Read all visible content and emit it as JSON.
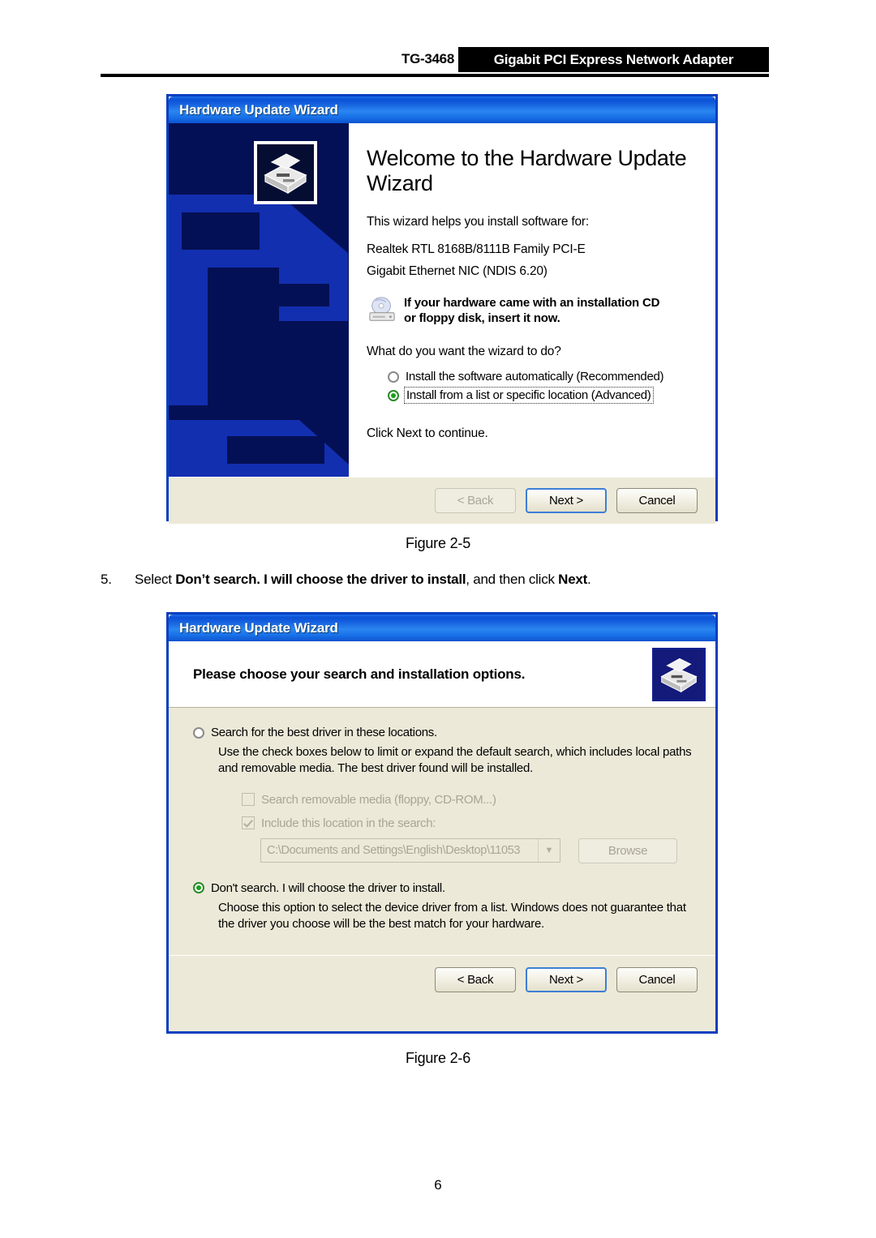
{
  "header": {
    "model": "TG-3468",
    "product": "Gigabit PCI Express Network Adapter"
  },
  "dialog_welcome": {
    "titlebar": "Hardware Update Wizard",
    "heading": "Welcome to the Hardware Update Wizard",
    "intro": "This wizard helps you install software for:",
    "device_line1": "Realtek RTL 8168B/8111B Family PCI-E",
    "device_line2": "Gigabit Ethernet NIC (NDIS 6.20)",
    "cd_note_line1": "If your hardware came with an installation CD",
    "cd_note_line2": "or floppy disk, insert it now.",
    "question": "What do you want the wizard to do?",
    "options": [
      {
        "label": "Install the software automatically (Recommended)",
        "selected": false,
        "focused": false
      },
      {
        "label": "Install from a list or specific location (Advanced)",
        "selected": true,
        "focused": true
      }
    ],
    "click_next": "Click Next to continue.",
    "buttons": [
      {
        "label": "< Back",
        "state": "disabled"
      },
      {
        "label": "Next >",
        "state": "default"
      },
      {
        "label": "Cancel",
        "state": "normal"
      }
    ]
  },
  "dialog_options": {
    "titlebar": "Hardware Update Wizard",
    "heading": "Please choose your search and installation options.",
    "option_search": {
      "label": "Search for the best driver in these locations.",
      "selected": false,
      "description": "Use the check boxes below to limit or expand the default search, which includes local paths and removable media. The best driver found will be installed."
    },
    "checkbox_removable": {
      "label": "Search removable media (floppy, CD-ROM...)",
      "checked": false,
      "enabled": false
    },
    "checkbox_include": {
      "label": "Include this location in the search:",
      "checked": true,
      "enabled": false
    },
    "path_combo": {
      "value": "C:\\Documents and Settings\\English\\Desktop\\11053",
      "enabled": false
    },
    "browse_button": {
      "label": "Browse",
      "enabled": false
    },
    "option_dontsearch": {
      "label": "Don't search. I will choose the driver to install.",
      "selected": true,
      "description": "Choose this option to select the device driver from a list.  Windows does not guarantee that the driver you choose will be the best match for your hardware."
    },
    "buttons": [
      {
        "label": "< Back",
        "state": "normal"
      },
      {
        "label": "Next >",
        "state": "default"
      },
      {
        "label": "Cancel",
        "state": "normal"
      }
    ]
  },
  "captions": {
    "figure_25": "Figure 2-5",
    "figure_26": "Figure 2-6"
  },
  "step": {
    "number": "5.",
    "text_before": "Select ",
    "text_bold1": "Don’t search. I will choose the driver to install",
    "text_middle": ", and then click ",
    "text_bold2": "Next",
    "text_after": "."
  },
  "page_number": "6",
  "colors": {
    "titlebar_blue": "#0b51d6",
    "dialog_border": "#0a3fc0",
    "dialog_face": "#ece9d8",
    "watermark_bg": "#041055",
    "watermark_fg": "#122fb0",
    "radio_green": "#1ba01b",
    "header_band": "#000000"
  }
}
